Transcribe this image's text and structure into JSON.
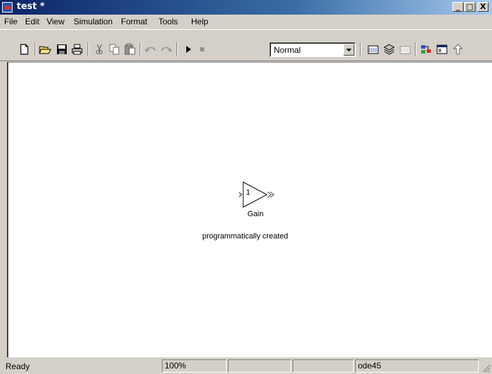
{
  "window": {
    "title": "test *",
    "controls": {
      "minimize": "_",
      "maximize": "□",
      "close": "X"
    }
  },
  "menu": [
    "File",
    "Edit",
    "View",
    "Simulation",
    "Format",
    "Tools",
    "Help"
  ],
  "toolbar": {
    "sim_mode": "Normal",
    "icons": [
      "new-icon",
      "open-icon",
      "save-icon",
      "print-icon",
      "cut-icon",
      "copy-icon",
      "paste-icon",
      "undo-icon",
      "redo-icon",
      "start-icon",
      "stop-icon",
      "build-icon",
      "update-diagram-icon",
      "build-subsystem-icon",
      "library-browser-icon",
      "model-explorer-icon",
      "go-to-parent-icon"
    ]
  },
  "diagram": {
    "block": {
      "value": "1",
      "name": "Gain"
    },
    "annotation": "programmatically created"
  },
  "status": {
    "state": "Ready",
    "zoom": "100%",
    "cell3": "",
    "cell4": "",
    "solver": "ode45"
  }
}
